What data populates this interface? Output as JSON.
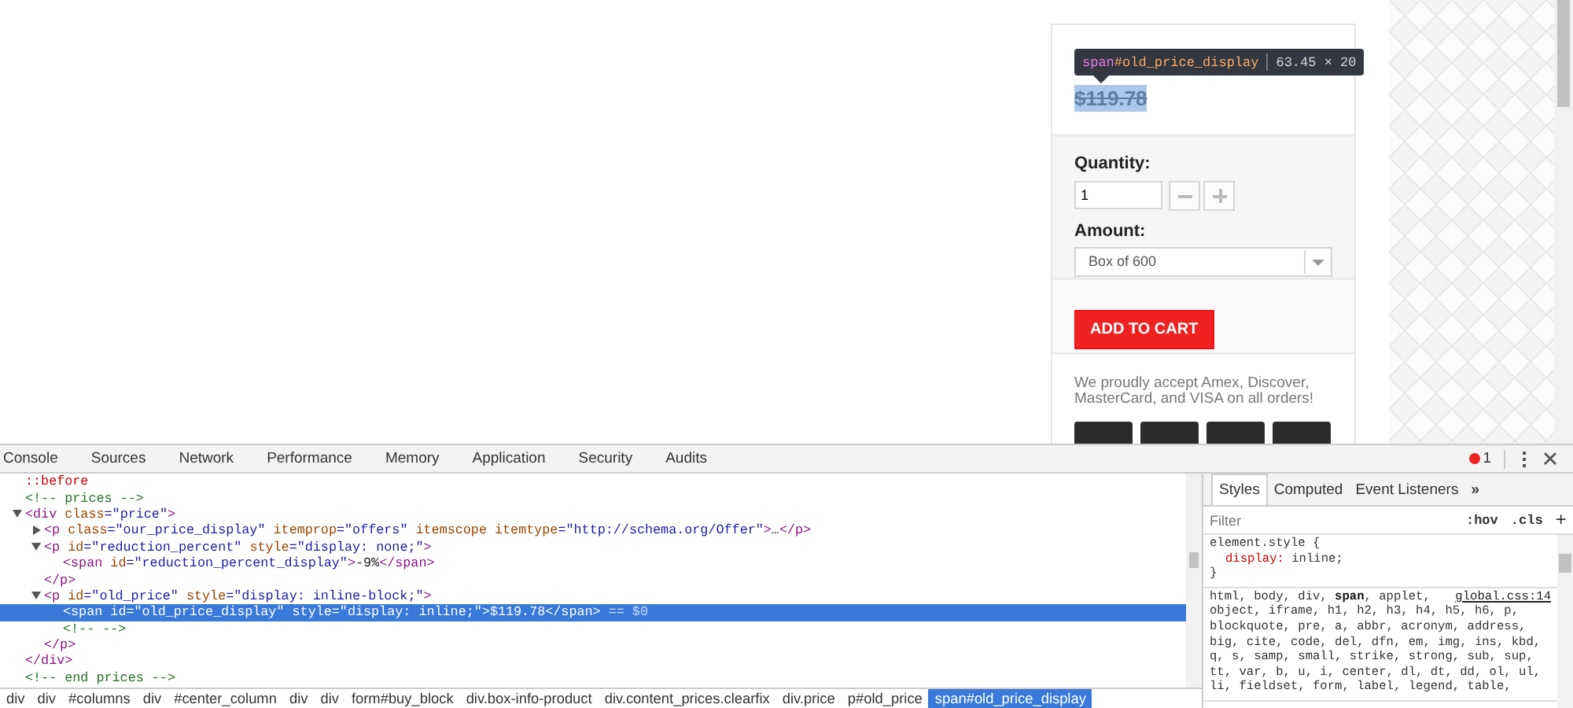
{
  "product": {
    "tooltip": {
      "tag": "span",
      "id": "#old_price_display",
      "size": "63.45 × 20"
    },
    "old_price": {
      "text": "$119.78",
      "highlighted": true
    },
    "quantity": {
      "label": "Quantity:",
      "value": "1"
    },
    "amount": {
      "label": "Amount:",
      "value": "Box of 600"
    },
    "add_button": "ADD TO CART",
    "accept_text": "We proudly accept Amex, Discover, MasterCard, and VISA on all orders!"
  },
  "devtools": {
    "tabs": [
      {
        "label": "Console",
        "selected": false
      },
      {
        "label": "Sources",
        "selected": false
      },
      {
        "label": "Network",
        "selected": false
      },
      {
        "label": "Performance",
        "selected": false
      },
      {
        "label": "Memory",
        "selected": false
      },
      {
        "label": "Application",
        "selected": false
      },
      {
        "label": "Security",
        "selected": false
      },
      {
        "label": "Audits",
        "selected": false
      }
    ],
    "error_count": "1",
    "dom": [
      {
        "selected": false,
        "tokens": [
          {
            "kind": "pseudo",
            "text": "::before"
          }
        ]
      },
      {
        "selected": false,
        "tokens": [
          {
            "kind": "comment",
            "text": "<!-- prices -->"
          }
        ]
      },
      {
        "selected": false,
        "expanded": true,
        "tokens": [
          {
            "kind": "tag",
            "text": "<div"
          },
          {
            "kind": "attr",
            "text": " class"
          },
          {
            "kind": "value",
            "text": "=\"price\""
          },
          {
            "kind": "tag",
            "text": ">"
          }
        ],
        "close": [
          {
            "kind": "tag",
            "text": "</div>"
          }
        ],
        "children": [
          {
            "selected": false,
            "expanded": false,
            "tokens": [
              {
                "kind": "tag",
                "text": "<p"
              },
              {
                "kind": "attr",
                "text": " class"
              },
              {
                "kind": "value",
                "text": "=\"our_price_display\""
              },
              {
                "kind": "attr",
                "text": " itemprop"
              },
              {
                "kind": "value",
                "text": "=\"offers\""
              },
              {
                "kind": "attr",
                "text": " itemscope itemtype"
              },
              {
                "kind": "value",
                "text": "=\"http://schema.org/Offer\""
              },
              {
                "kind": "tag",
                "text": ">"
              },
              {
                "kind": "text",
                "text": "…"
              },
              {
                "kind": "tag",
                "text": "</p>"
              }
            ]
          },
          {
            "selected": false,
            "expanded": true,
            "tokens": [
              {
                "kind": "tag",
                "text": "<p"
              },
              {
                "kind": "attr",
                "text": " id"
              },
              {
                "kind": "value",
                "text": "=\"reduction_percent\""
              },
              {
                "kind": "attr",
                "text": " style"
              },
              {
                "kind": "value",
                "text": "=\"display: none;\""
              },
              {
                "kind": "tag",
                "text": ">"
              }
            ],
            "close": [
              {
                "kind": "tag",
                "text": "</p>"
              }
            ],
            "children": [
              {
                "selected": false,
                "tokens": [
                  {
                    "kind": "tag",
                    "text": "<span"
                  },
                  {
                    "kind": "attr",
                    "text": " id"
                  },
                  {
                    "kind": "value",
                    "text": "=\"reduction_percent_display\""
                  },
                  {
                    "kind": "tag",
                    "text": ">"
                  },
                  {
                    "kind": "text",
                    "text": "-9%"
                  },
                  {
                    "kind": "tag",
                    "text": "</span>"
                  }
                ]
              }
            ]
          },
          {
            "selected": false,
            "expanded": true,
            "tokens": [
              {
                "kind": "tag",
                "text": "<p"
              },
              {
                "kind": "attr",
                "text": " id"
              },
              {
                "kind": "value",
                "text": "=\"old_price\""
              },
              {
                "kind": "attr",
                "text": " style"
              },
              {
                "kind": "value",
                "text": "=\"display: inline-block;\""
              },
              {
                "kind": "tag",
                "text": ">"
              }
            ],
            "close": [
              {
                "kind": "tag",
                "text": "</p>"
              }
            ],
            "children": [
              {
                "selected": true,
                "tokens": [
                  {
                    "kind": "tag",
                    "text": "<span"
                  },
                  {
                    "kind": "attr",
                    "text": " id"
                  },
                  {
                    "kind": "value",
                    "text": "=\"old_price_display\""
                  },
                  {
                    "kind": "attr",
                    "text": " style"
                  },
                  {
                    "kind": "value",
                    "text": "=\"display: inline;\""
                  },
                  {
                    "kind": "tag",
                    "text": ">"
                  },
                  {
                    "kind": "text",
                    "text": "$119.78"
                  },
                  {
                    "kind": "tag",
                    "text": "</span>"
                  },
                  {
                    "kind": "ref",
                    "text": " == $0"
                  }
                ]
              },
              {
                "selected": false,
                "tokens": [
                  {
                    "kind": "comment",
                    "text": "<!--  -->"
                  }
                ]
              }
            ]
          }
        ]
      },
      {
        "selected": false,
        "tokens": [
          {
            "kind": "comment",
            "text": "<!-- end prices -->"
          }
        ]
      }
    ],
    "breadcrumbs": [
      {
        "label": "div",
        "selected": false
      },
      {
        "label": "div",
        "selected": false
      },
      {
        "label": "#columns",
        "selected": false
      },
      {
        "label": "div",
        "selected": false
      },
      {
        "label": "#center_column",
        "selected": false
      },
      {
        "label": "div",
        "selected": false
      },
      {
        "label": "div",
        "selected": false
      },
      {
        "label": "form#buy_block",
        "selected": false
      },
      {
        "label": "div.box-info-product",
        "selected": false
      },
      {
        "label": "div.content_prices.clearfix",
        "selected": false
      },
      {
        "label": "div.price",
        "selected": false
      },
      {
        "label": "p#old_price",
        "selected": false
      },
      {
        "label": "span#old_price_display",
        "selected": true
      }
    ],
    "styles": {
      "tabs": [
        {
          "label": "Styles",
          "selected": true
        },
        {
          "label": "Computed",
          "selected": false
        },
        {
          "label": "Event Listeners",
          "selected": false
        }
      ],
      "more": "»",
      "filter_placeholder": "Filter",
      "hov": ":hov",
      "cls": ".cls",
      "add": "+",
      "rules": [
        {
          "selector": "element.style {",
          "declarations": [
            {
              "property": "display:",
              "value": "inline;"
            }
          ],
          "close": "}"
        },
        {
          "selector_lines": [
            "html, body, div, **span**, applet,",
            "object, iframe, h1, h2, h3, h4, h5, h6, p,",
            "blockquote, pre, a, abbr, acronym, address,",
            "big, cite, code, del, dfn, em, img, ins, kbd,",
            "q, s, samp, small, strike, strong, sub, sup,",
            "tt, var, b, u, i, center, dl, dt, dd, ol, ul,",
            "li, fieldset, form, label, legend, table,"
          ],
          "source": "global.css:14"
        }
      ]
    }
  }
}
